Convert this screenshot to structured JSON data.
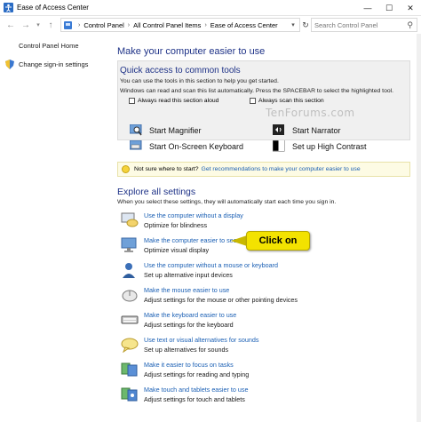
{
  "window": {
    "title": "Ease of Access Center",
    "minimize_glyph": "—",
    "maximize_glyph": "☐",
    "close_glyph": "✕"
  },
  "nav": {
    "back_glyph": "←",
    "forward_glyph": "→",
    "up_glyph": "↑",
    "breadcrumbs": [
      "Control Panel",
      "All Control Panel Items",
      "Ease of Access Center"
    ],
    "search_placeholder": "Search Control Panel"
  },
  "sidebar": {
    "home_label": "Control Panel Home",
    "signin_label": "Change sign-in settings"
  },
  "main": {
    "heading": "Make your computer easier to use",
    "quick_access": {
      "title": "Quick access to common tools",
      "line1": "You can use the tools in this section to help you get started.",
      "line2": "Windows can read and scan this list automatically.  Press the SPACEBAR to select the highlighted tool.",
      "check_read": "Always read this section aloud",
      "check_scan": "Always scan this section",
      "watermark": "TenForums.com"
    },
    "tools": {
      "magnifier": "Start Magnifier",
      "narrator": "Start Narrator",
      "keyboard": "Start On-Screen Keyboard",
      "contrast": "Set up High Contrast"
    },
    "tip": {
      "prefix": "Not sure where to start?",
      "link": "Get recommendations to make your computer easier to use"
    },
    "explore": {
      "heading": "Explore all settings",
      "description": "When you select these settings, they will automatically start each time you sign in."
    },
    "settings": [
      {
        "link": "Use the computer without a display",
        "desc": "Optimize for blindness"
      },
      {
        "link": "Make the computer easier to see",
        "desc": "Optimize visual display"
      },
      {
        "link": "Use the computer without a mouse or keyboard",
        "desc": "Set up alternative input devices"
      },
      {
        "link": "Make the mouse easier to use",
        "desc": "Adjust settings for the mouse or other pointing devices"
      },
      {
        "link": "Make the keyboard easier to use",
        "desc": "Adjust settings for the keyboard"
      },
      {
        "link": "Use text or visual alternatives for sounds",
        "desc": "Set up alternatives for sounds"
      },
      {
        "link": "Make it easier to focus on tasks",
        "desc": "Adjust settings for reading and typing"
      },
      {
        "link": "Make touch and tablets easier to use",
        "desc": "Adjust settings for touch and tablets"
      }
    ],
    "callout": "Click on"
  },
  "colors": {
    "heading": "#1e3287",
    "link": "#1a5fb4",
    "callout": "#f3e200"
  }
}
